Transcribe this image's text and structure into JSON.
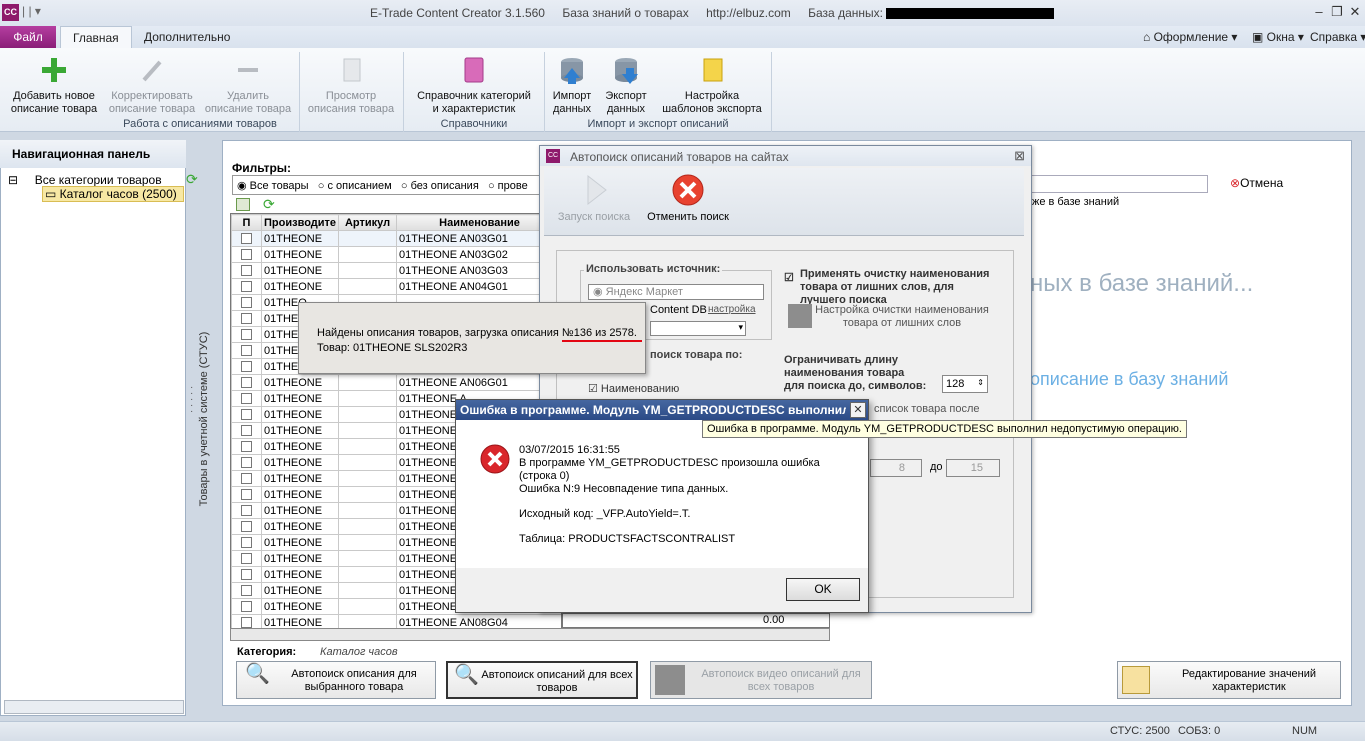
{
  "app": {
    "title": "E-Trade Content Creator 3.1.560",
    "knowledge_base": "База знаний о товарах",
    "url": "http://elbuz.com",
    "db_label": "База данных:",
    "icon_text": "CC"
  },
  "ribbon_tabs": [
    "Файл",
    "Главная",
    "Дополнительно"
  ],
  "right_menu": {
    "style": "Оформление",
    "windows": "Окна",
    "help": "Справка"
  },
  "ribbon": {
    "add": [
      "Добавить новое",
      "описание товара"
    ],
    "edit": [
      "Корректировать",
      "описание товара"
    ],
    "delete": [
      "Удалить",
      "описание товара"
    ],
    "view": [
      "Просмотр",
      "описания товара"
    ],
    "refs": [
      "Справочник категорий",
      "и характеристик"
    ],
    "import": [
      "Импорт",
      "данных"
    ],
    "export": [
      "Экспорт",
      "данных"
    ],
    "templates": [
      "Настройка",
      "шаблонов экспорта"
    ],
    "group1": "Работа с описаниями товаров",
    "group2": "Справочники",
    "group3": "Импорт и экспорт описаний"
  },
  "nav": {
    "header": "Навигационная панель",
    "root": "Все категории товаров",
    "child": "Каталог часов (2500)",
    "vertical_label": "Товары в учетной системе (СТУС)"
  },
  "filters": {
    "label": "Фильтры:",
    "options": [
      "Все товары",
      "с описанием",
      "без описания",
      "прове"
    ]
  },
  "grid": {
    "columns": [
      "П",
      "Производите",
      "Артикул",
      "Наименование"
    ],
    "rows": [
      [
        "01THEONE",
        "01THEONE AN03G01"
      ],
      [
        "01THEONE",
        "01THEONE AN03G02"
      ],
      [
        "01THEONE",
        "01THEONE AN03G03"
      ],
      [
        "01THEONE",
        "01THEONE AN04G01"
      ],
      [
        "01THEO",
        ""
      ],
      [
        "01THEO",
        ""
      ],
      [
        "01THEO",
        ""
      ],
      [
        "01THEO",
        ""
      ],
      [
        "01THEO",
        ""
      ],
      [
        "01THEONE",
        "01THEONE AN06G01"
      ],
      [
        "01THEONE",
        "01THEONE A"
      ],
      [
        "01THEONE",
        "01THEONE A"
      ],
      [
        "01THEONE",
        "01THEONE A"
      ],
      [
        "01THEONE",
        "01THEONE A"
      ],
      [
        "01THEONE",
        "01THEONE A"
      ],
      [
        "01THEONE",
        "01THEONE A"
      ],
      [
        "01THEONE",
        "01THEONE A"
      ],
      [
        "01THEONE",
        "01THEONE A"
      ],
      [
        "01THEONE",
        "01THEONE A"
      ],
      [
        "01THEONE",
        "01THEONE A"
      ],
      [
        "01THEONE",
        "01THEONE AN"
      ],
      [
        "01THEONE",
        "01THEONE A"
      ],
      [
        "01THEONE",
        "01THEONE A"
      ],
      [
        "01THEONE",
        "01THEONE A"
      ],
      [
        "01THEONE",
        "01THEONE AN08G04"
      ]
    ],
    "price_cell": "0.00"
  },
  "category": {
    "label": "Категория:",
    "value": "Каталог часов"
  },
  "bottom_buttons": {
    "auto_selected": [
      "Автопоиск описания для",
      "выбранного товара"
    ],
    "auto_all": [
      "Автопоиск описаний для всех",
      "товаров"
    ],
    "auto_video": [
      "Автопоиск видео описаний для",
      "всех товаров"
    ],
    "edit_values": [
      "Редактирование значений",
      "характеристик"
    ]
  },
  "right_panel": {
    "cancel": "Отмена",
    "kb_text": "же в базе знаний",
    "big_text": "ных в базе знаний...",
    "link_text": "описание в базу знаний"
  },
  "autosearch": {
    "title": "Автопоиск описаний товаров на сайтах",
    "start": "Запуск поиска",
    "cancel": "Отменить поиск",
    "use_source": "Использовать источник:",
    "yandex": "Яндекс Маркет",
    "content_db": "Content DB",
    "setup_link": "настройка",
    "search_by": "поиск товара по:",
    "by_name": "Наименованию",
    "apply_clean": [
      "Применять очистку наименования",
      "товара от лишних слов, для",
      "лучшего поиска"
    ],
    "clean_setup": [
      "Настройка очистки наименования",
      "товара от лишних слов"
    ],
    "limit_len": [
      "Ограничивать длину",
      "наименования товара",
      "для поиска до, символов:"
    ],
    "limit_value": "128",
    "list_after": "список товара после",
    "range_from": "8",
    "range_to_label": "до",
    "range_to": "15"
  },
  "progress": {
    "line1_prefix": "Найдены описания товаров, загрузка описания ",
    "line1_count": "№136 из 2578.",
    "line2": "Товар: 01THEONE SLS202R3"
  },
  "error": {
    "title": "Ошибка в программе. Модуль YM_GETPRODUCTDESC выполнил н...",
    "tooltip": "Ошибка в программе. Модуль YM_GETPRODUCTDESC выполнил недопустимую операцию.",
    "datetime": "03/07/2015 16:31:55",
    "message": "В программе YM_GETPRODUCTDESC произошла ошибка (строка 0)",
    "error_no": "Ошибка N:9 Несовпадение типа данных.",
    "source": "Исходный код: _VFP.AutoYield=.T.",
    "table": "Таблица: PRODUCTSFACTSCONTRALIST",
    "ok": "OK"
  },
  "status": {
    "stus": "СТУС: 2500",
    "sobz": "СОБЗ: 0",
    "num": "NUM"
  },
  "colors": {
    "accent": "#8e1a6b",
    "error_red": "#d9262b",
    "title_blue": "#2b4a86",
    "underline": "#e30613"
  }
}
